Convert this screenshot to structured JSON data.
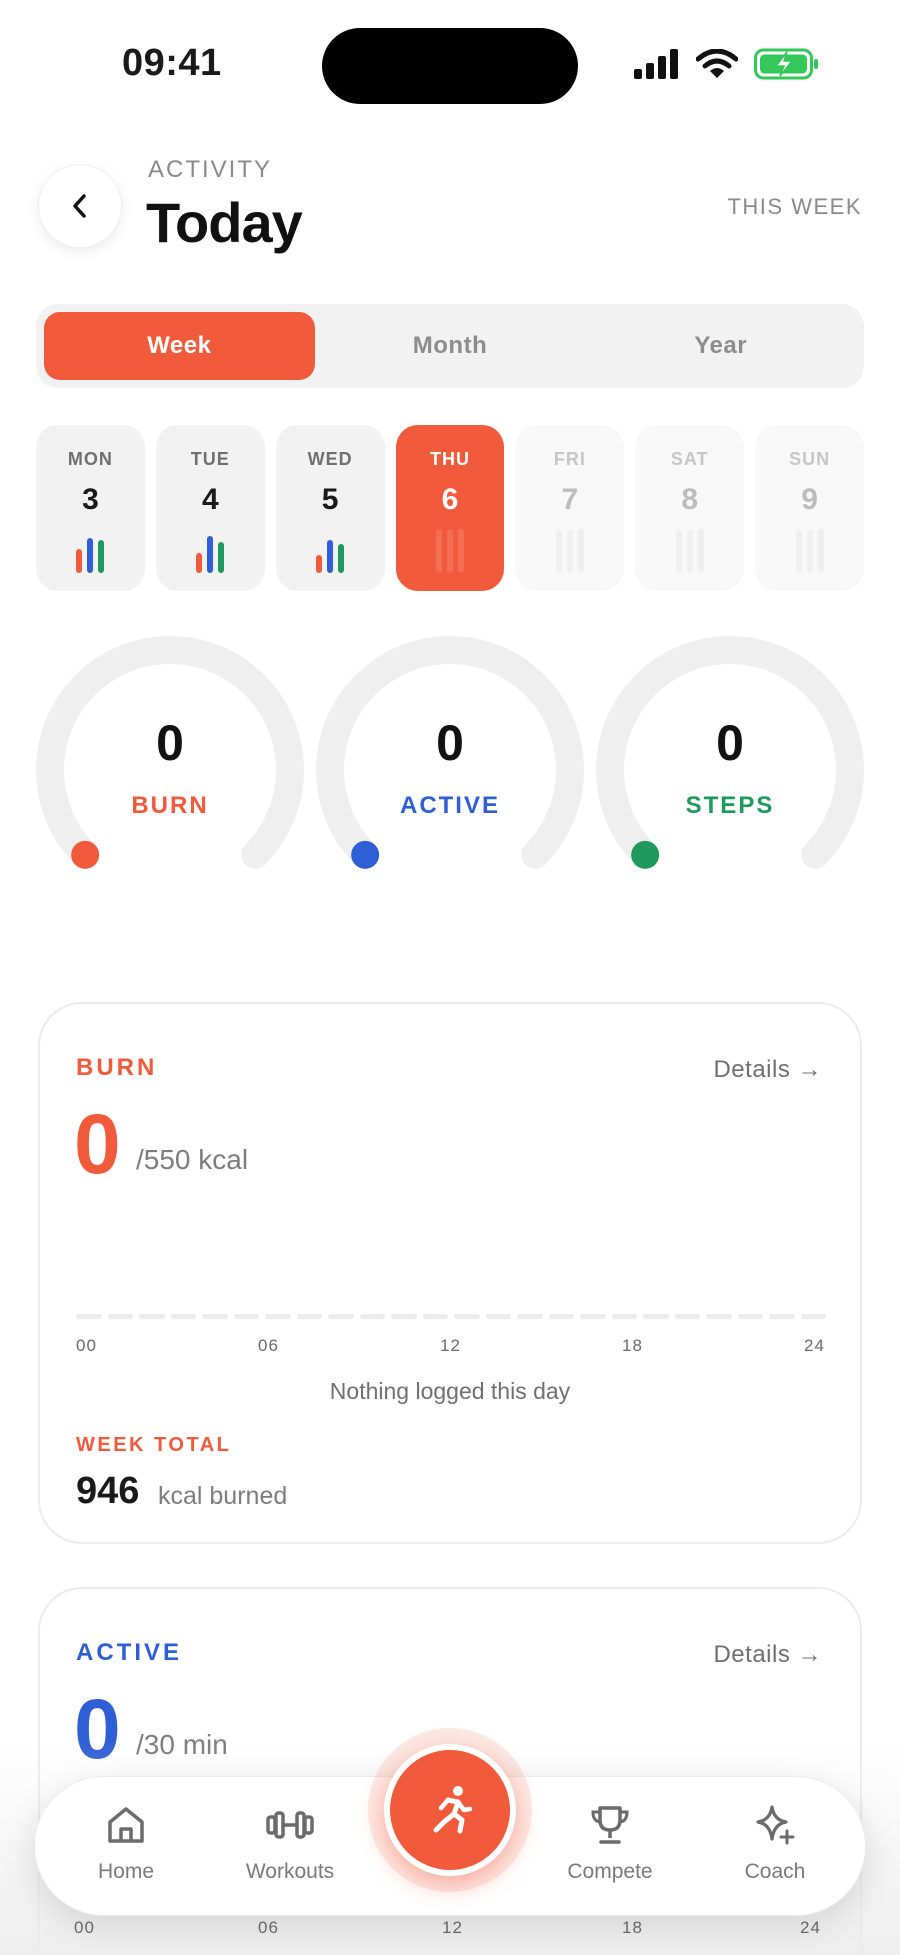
{
  "status_bar": {
    "time": "09:41"
  },
  "header": {
    "eyebrow": "ACTIVITY",
    "title": "Today",
    "range_label": "THIS WEEK"
  },
  "segments": [
    {
      "label": "Week",
      "active": true
    },
    {
      "label": "Month",
      "active": false
    },
    {
      "label": "Year",
      "active": false
    }
  ],
  "days": [
    {
      "name": "MON",
      "num": "3",
      "state": "past",
      "bars": [
        0.55,
        0.8,
        0.75
      ]
    },
    {
      "name": "TUE",
      "num": "4",
      "state": "past",
      "bars": [
        0.45,
        0.85,
        0.7
      ]
    },
    {
      "name": "WED",
      "num": "5",
      "state": "past",
      "bars": [
        0.4,
        0.75,
        0.65
      ]
    },
    {
      "name": "THU",
      "num": "6",
      "state": "selected",
      "bars": [
        0,
        0,
        0
      ]
    },
    {
      "name": "FRI",
      "num": "7",
      "state": "future",
      "bars": [
        0,
        0,
        0
      ]
    },
    {
      "name": "SAT",
      "num": "8",
      "state": "future",
      "bars": [
        0,
        0,
        0
      ]
    },
    {
      "name": "SUN",
      "num": "9",
      "state": "future",
      "bars": [
        0,
        0,
        0
      ]
    }
  ],
  "rings": [
    {
      "value": "0",
      "label": "BURN",
      "color": "#f25a3c",
      "progress": 0
    },
    {
      "value": "0",
      "label": "ACTIVE",
      "color": "#2f5fd6",
      "progress": 0
    },
    {
      "value": "0",
      "label": "STEPS",
      "color": "#1f9a5c",
      "progress": 0
    }
  ],
  "burn_card": {
    "label": "BURN",
    "details": "Details →",
    "value": "0",
    "goal": "/550 kcal",
    "ticks": [
      "00",
      "06",
      "12",
      "18",
      "24"
    ],
    "empty_message": "Nothing logged this day",
    "week_label": "WEEK TOTAL",
    "week_total": "946",
    "week_unit": "kcal burned"
  },
  "active_card": {
    "label": "ACTIVE",
    "details": "Details →",
    "value": "0",
    "goal": "/30 min",
    "ticks": [
      "00",
      "06",
      "12",
      "18",
      "24"
    ]
  },
  "nav": {
    "items": [
      {
        "label": "Home",
        "icon": "home-icon"
      },
      {
        "label": "Workouts",
        "icon": "dumbbell-icon"
      },
      {
        "label": "Compete",
        "icon": "trophy-icon"
      },
      {
        "label": "Coach",
        "icon": "sparkle-icon"
      }
    ],
    "fab_icon": "running-person-icon"
  },
  "colors": {
    "accent": "#f25a3c",
    "burn": "#f25a3c",
    "active": "#2f5fd6",
    "steps": "#1f9a5c",
    "battery": "#34c759"
  }
}
